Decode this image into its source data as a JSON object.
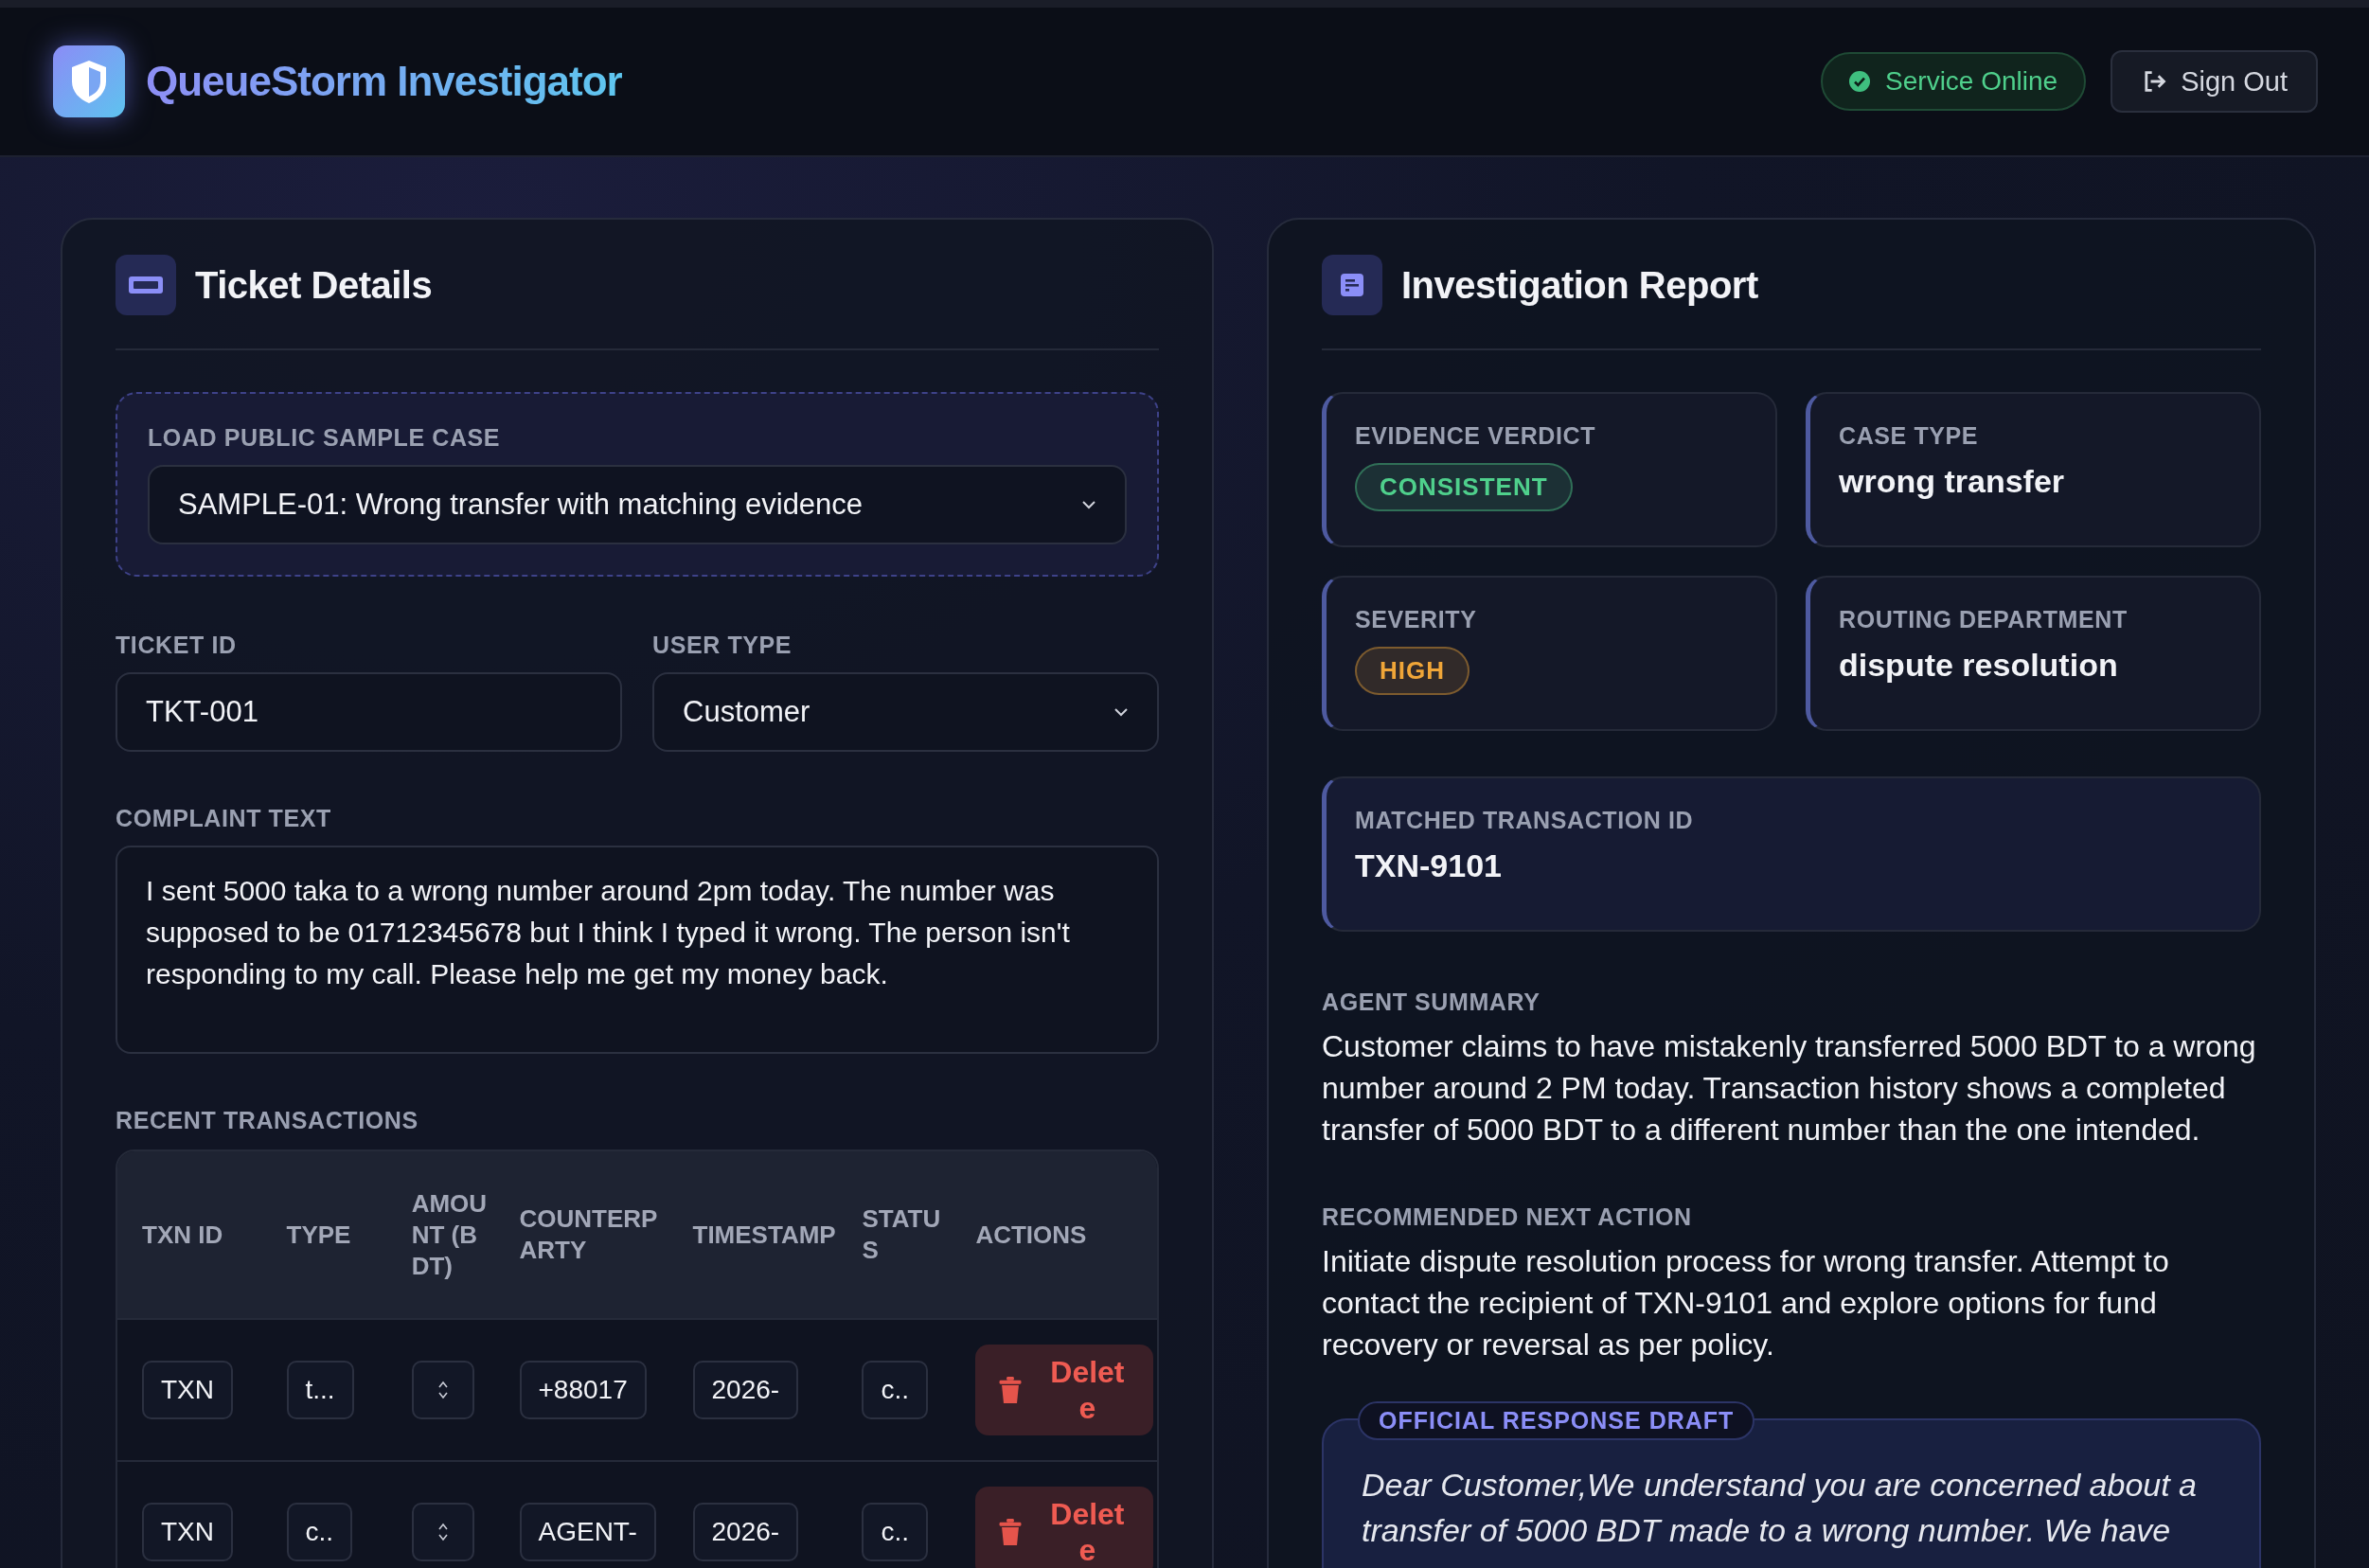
{
  "app": {
    "title": "QueueStorm Investigator",
    "status": "Service Online",
    "sign_out": "Sign Out"
  },
  "ticket": {
    "title": "Ticket Details",
    "sample": {
      "label": "LOAD PUBLIC SAMPLE CASE",
      "value": "SAMPLE-01: Wrong transfer with matching evidence"
    },
    "ticket_id": {
      "label": "TICKET ID",
      "value": "TKT-001"
    },
    "user_type": {
      "label": "USER TYPE",
      "value": "Customer"
    },
    "complaint": {
      "label": "COMPLAINT TEXT",
      "value": "I sent 5000 taka to a wrong number around 2pm today. The number was supposed to be 01712345678 but I think I typed it wrong. The person isn't responding to my call. Please help me get my money back."
    },
    "transactions": {
      "label": "RECENT TRANSACTIONS",
      "columns": [
        "TXN ID",
        "TYPE",
        "AMOUNT (BDT)",
        "COUNTERPARTY",
        "TIMESTAMP",
        "STATUS",
        "ACTIONS"
      ],
      "rows": [
        {
          "cells": [
            {
              "kind": "text",
              "value": "TXN"
            },
            {
              "kind": "text",
              "value": "t..."
            },
            {
              "kind": "number"
            },
            {
              "kind": "text",
              "value": "+88017"
            },
            {
              "kind": "text",
              "value": "2026-"
            },
            {
              "kind": "text",
              "value": "c.."
            }
          ],
          "action": "Delete"
        },
        {
          "cells": [
            {
              "kind": "text",
              "value": "TXN"
            },
            {
              "kind": "text",
              "value": "c.."
            },
            {
              "kind": "number"
            },
            {
              "kind": "text",
              "value": "AGENT-"
            },
            {
              "kind": "text",
              "value": "2026-"
            },
            {
              "kind": "text",
              "value": "c.."
            }
          ],
          "action": "Delete"
        }
      ]
    }
  },
  "report": {
    "title": "Investigation Report",
    "stats": [
      {
        "label": "EVIDENCE VERDICT",
        "kind": "pill",
        "color": "#4fd08c",
        "value": "CONSISTENT"
      },
      {
        "label": "CASE TYPE",
        "kind": "text",
        "value": "wrong transfer"
      },
      {
        "label": "SEVERITY",
        "kind": "pill",
        "color": "#f0a638",
        "value": "HIGH"
      },
      {
        "label": "ROUTING DEPARTMENT",
        "kind": "text",
        "value": "dispute resolution"
      }
    ],
    "matched": {
      "label": "MATCHED TRANSACTION ID",
      "value": "TXN-9101"
    },
    "summary": {
      "label": "AGENT SUMMARY",
      "text": "Customer claims to have mistakenly transferred 5000 BDT to a wrong number around 2 PM today. Transaction history shows a completed transfer of 5000 BDT to a different number than the one intended."
    },
    "next_action": {
      "label": "RECOMMENDED NEXT ACTION",
      "text": "Initiate dispute resolution process for wrong transfer. Attempt to contact the recipient of TXN-9101 and explore options for fund recovery or reversal as per policy."
    },
    "draft": {
      "label": "OFFICIAL RESPONSE DRAFT",
      "text": "Dear Customer,We understand you are concerned about a transfer of 5000 BDT made to a wrong number. We have"
    }
  }
}
